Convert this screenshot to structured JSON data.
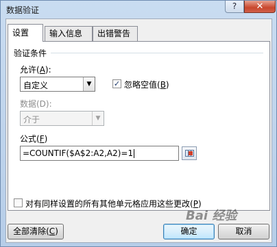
{
  "window": {
    "title": "数据验证",
    "help_glyph": "?",
    "close_glyph": "✕"
  },
  "tabs": [
    {
      "label": "设置"
    },
    {
      "label": "输入信息"
    },
    {
      "label": "出错警告"
    }
  ],
  "settings": {
    "section_title": "验证条件",
    "allow": {
      "label_pre": "允许(",
      "label_key": "A",
      "label_post": "):",
      "value": "自定义"
    },
    "ignore_blank": {
      "label_pre": "忽略空值(",
      "label_key": "B",
      "label_post": ")",
      "checked": true,
      "check_glyph": "✓"
    },
    "data": {
      "label": "数据(D):",
      "value": "介于"
    },
    "formula": {
      "label_pre": "公式(",
      "label_key": "F",
      "label_post": ")",
      "value": "=COUNTIF($A$2:A2,A2)=1"
    }
  },
  "apply_all": {
    "label_pre": "对有同样设置的所有其他单元格应用这些更改(",
    "label_key": "P",
    "label_post": ")",
    "checked": false
  },
  "buttons": {
    "clear_all": {
      "label_pre": "全部清除(",
      "label_key": "C",
      "label_post": ")"
    },
    "ok": "确定",
    "cancel": "取消"
  },
  "watermark": "Bai 经验",
  "icons": {
    "dropdown": "▼"
  }
}
